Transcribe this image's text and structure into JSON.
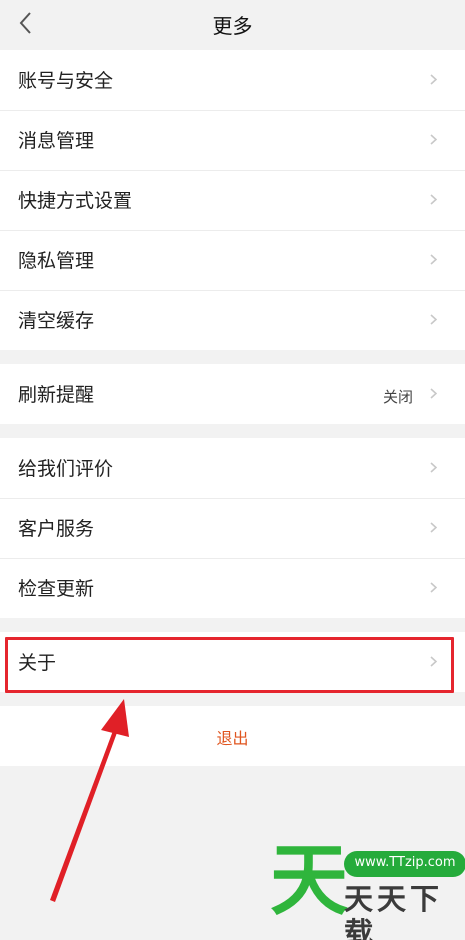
{
  "header": {
    "title": "更多",
    "back_icon": "chevron-left-icon"
  },
  "groups": [
    {
      "items": [
        {
          "label": "账号与安全"
        },
        {
          "label": "消息管理"
        },
        {
          "label": "快捷方式设置"
        },
        {
          "label": "隐私管理"
        },
        {
          "label": "清空缓存"
        }
      ]
    },
    {
      "items": [
        {
          "label": "刷新提醒",
          "value": "关闭"
        }
      ]
    },
    {
      "items": [
        {
          "label": "给我们评价"
        },
        {
          "label": "客户服务"
        },
        {
          "label": "检查更新"
        }
      ]
    },
    {
      "items": [
        {
          "label": "关于"
        }
      ]
    }
  ],
  "logout": {
    "label": "退出"
  },
  "colors": {
    "background": "#f2f2f2",
    "card": "#ffffff",
    "logout_text": "#e0551f",
    "annotation_red": "#e5262e",
    "watermark_green": "#2fb53c"
  },
  "watermark": {
    "big_char": "天",
    "text": "天天下载",
    "url": "www.TTzip.com"
  }
}
